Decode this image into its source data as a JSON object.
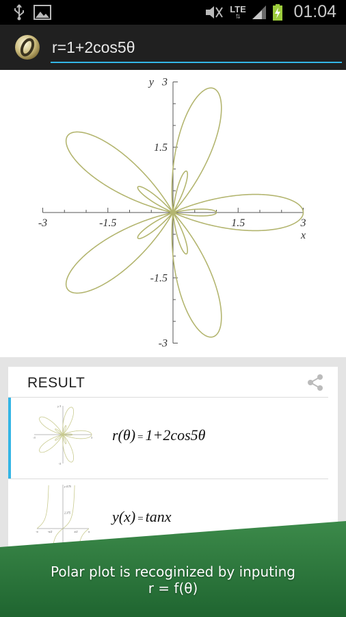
{
  "status_bar": {
    "network_label": "LTE",
    "time": "01:04",
    "icons": [
      "usb-icon",
      "image-notification-icon",
      "mute-icon",
      "signal-icon",
      "battery-charging-icon"
    ]
  },
  "action_bar": {
    "formula_value": "r=1+2cos5θ",
    "logo_icon": "app-logo-icon"
  },
  "plot": {
    "chart_data": {
      "type": "line",
      "equation": "r=1+2cos5θ",
      "coordinate_system": "polar",
      "xlabel": "x",
      "ylabel": "y",
      "xlim": [
        -3,
        3
      ],
      "ylim": [
        -3,
        3
      ],
      "x_ticks": [
        "-3",
        "-1.5",
        "1.5",
        "3"
      ],
      "y_ticks": [
        "3",
        "1.5",
        "-1.5",
        "-3"
      ],
      "curve_color": "#b3b56f"
    }
  },
  "result": {
    "title": "RESULT",
    "share_icon": "share-icon",
    "items": [
      {
        "formula_lhs": "r(θ)",
        "formula_rhs": "1+2cos5θ",
        "thumbnail": "polar-rose-thumbnail",
        "selected": true,
        "thumb_ticks": {
          "y_top": "y 3",
          "y_bottom": "-3",
          "x_left": "-3",
          "x_right": "3"
        }
      },
      {
        "formula_lhs": "y(x)",
        "formula_rhs": "tanx",
        "thumbnail": "tangent-thumbnail",
        "selected": false,
        "thumb_ticks": {
          "y_top": "y 4.75",
          "y_mid": "2.375",
          "y_low": "-2.375",
          "x_labels": [
            "-π",
            "-π/2",
            "π/2",
            "π"
          ]
        }
      }
    ]
  },
  "banner": {
    "line1": "Polar plot is recoginized by inputing",
    "line2": "r = f(θ)",
    "color": "#2d7a3c"
  }
}
